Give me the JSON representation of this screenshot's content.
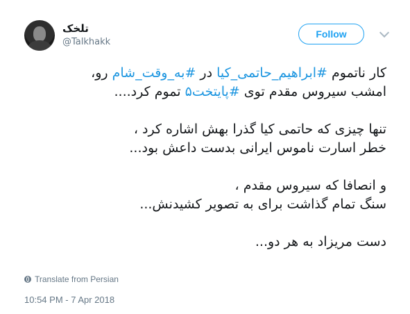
{
  "author": {
    "display_name": "تلخک",
    "handle": "@Talkhakk",
    "avatar_icon": "user-avatar"
  },
  "follow_label": "Follow",
  "tweet": {
    "p1_l1_a": "کار ناتموم ",
    "p1_l1_tag1": "#ابراهیم_حاتمی_کیا",
    "p1_l1_b": " در ",
    "p1_l1_tag2": "#به_وقت_شام",
    "p1_l1_c": " رو،",
    "p1_l2_a": "امشب سیروس مقدم توی ",
    "p1_l2_tag": "#پایتخت۵",
    "p1_l2_b": " تموم کرد....",
    "p2_l1": "تنها چیزی که حاتمی کیا گذرا بهش اشاره کرد ،",
    "p2_l2": "خطر اسارت ناموس ایرانی بدست داعش بود...",
    "p3_l1": "و انصافا که سیروس مقدم ،",
    "p3_l2": "سنگ تمام گذاشت برای به تصویر کشیدنش...",
    "p4_l1": "دست مریزاد به هر دو..."
  },
  "translate_label": "Translate from Persian",
  "timestamp": "10:54 PM - 7 Apr 2018",
  "colors": {
    "link": "#1b95e0",
    "follow": "#1da1f2",
    "muted": "#657786"
  }
}
